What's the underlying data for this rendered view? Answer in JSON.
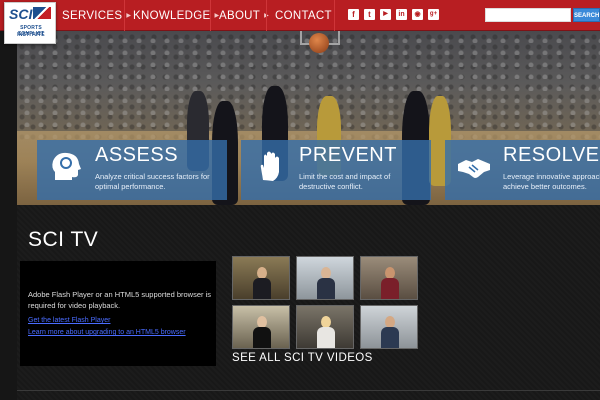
{
  "header": {
    "logo_text": "SCI",
    "logo_line1": "SPORTS CONFLICT",
    "logo_line2": "INSTITUTE",
    "nav": [
      {
        "label": "SERVICES"
      },
      {
        "label": "KNOWLEDGE"
      },
      {
        "label": "ABOUT"
      },
      {
        "label": "CONTACT"
      }
    ],
    "social_icons": [
      "facebook-icon",
      "twitter-icon",
      "youtube-icon",
      "linkedin-icon",
      "rss-icon",
      "google-plus-icon"
    ],
    "social_glyphs": [
      "f",
      "t",
      "▶",
      "in",
      "◉",
      "g+"
    ],
    "search_placeholder": "",
    "search_button": "SEARCH"
  },
  "hero": {
    "panels": [
      {
        "title": "ASSESS",
        "description": "Analyze critical success factors for optimal performance.",
        "icon": "head-icon"
      },
      {
        "title": "PREVENT",
        "description": "Limit the cost and impact of destructive conflict.",
        "icon": "hand-stop-icon"
      },
      {
        "title": "RESOLVE",
        "description": "Leverage innovative approaches to achieve better outcomes.",
        "icon": "handshake-icon"
      }
    ]
  },
  "tv": {
    "title": "SCI TV",
    "player_message": "Adobe Flash Player or an HTML5 supported browser is required for video playback.",
    "link_flash": "Get the latest Flash Player",
    "link_html5": "Learn more about upgrading to an HTML5 browser",
    "see_all": "SEE ALL SCI TV VIDEOS"
  },
  "colors": {
    "brand_red": "#b81e22",
    "panel_blue": "#346eaa",
    "link_blue": "#4a6cff"
  }
}
